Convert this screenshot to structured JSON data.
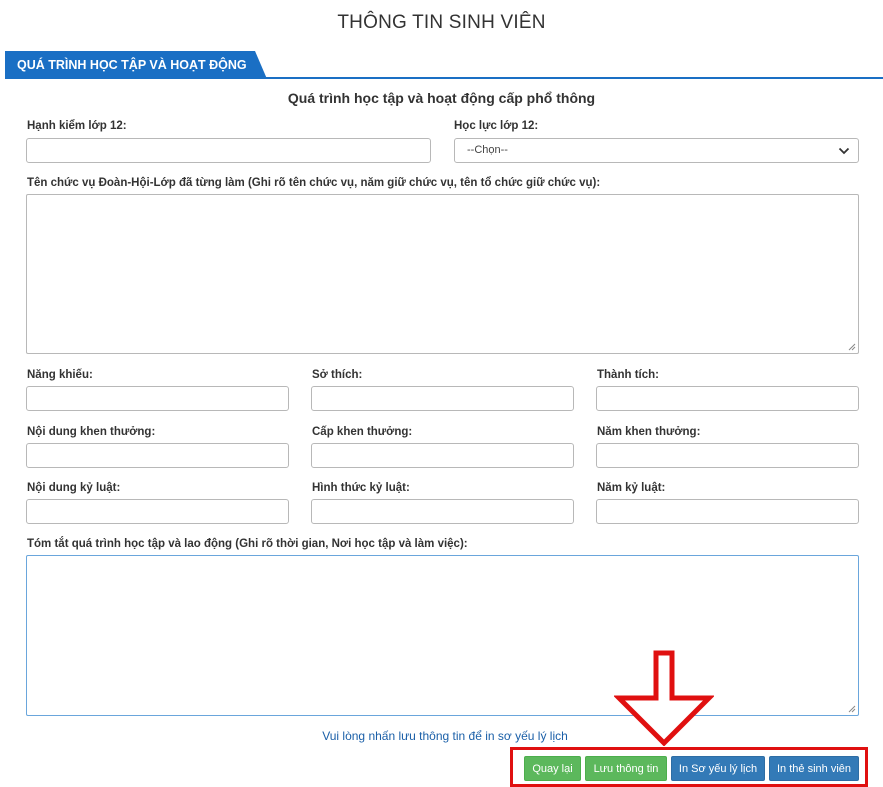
{
  "page": {
    "title": "THÔNG TIN SINH VIÊN"
  },
  "section": {
    "tab_label": "QUÁ TRÌNH HỌC TẬP VÀ HOẠT ĐỘNG",
    "subtitle": "Quá trình học tập và hoạt động cấp phổ thông"
  },
  "form": {
    "conduct_grade12_label": "Hạnh kiểm lớp 12:",
    "conduct_grade12_value": "",
    "academic_grade12_label": "Học lực lớp 12:",
    "academic_grade12_selected": "--Chọn--",
    "positions_label": "Tên chức vụ Đoàn-Hội-Lớp đã từng làm (Ghi rõ tên chức vụ, năm giữ chức vụ, tên tổ chức giữ chức vụ):",
    "positions_value": "",
    "talent_label": "Năng khiếu:",
    "hobby_label": "Sở thích:",
    "achievement_label": "Thành tích:",
    "reward_content_label": "Nội dung khen thưởng:",
    "reward_level_label": "Cấp khen thưởng:",
    "reward_year_label": "Năm khen thưởng:",
    "discipline_content_label": "Nội dung kỷ luật:",
    "discipline_form_label": "Hình thức kỷ luật:",
    "discipline_year_label": "Năm kỷ luật:",
    "summary_label": "Tóm tắt quá trình học tập và lao động (Ghi rõ thời gian, Nơi học tập và làm việc):",
    "summary_value": ""
  },
  "hint": "Vui lòng nhấn lưu thông tin để in sơ yếu lý lịch",
  "buttons": {
    "back": "Quay lại",
    "save": "Lưu thông tin",
    "print_cv": "In Sơ yếu lý lịch",
    "print_card": "In thẻ sinh viên"
  },
  "colors": {
    "primary_blue": "#1a6fc4",
    "button_green": "#5cb85c",
    "button_blue": "#337ab7",
    "highlight_red": "#e01010",
    "hint_link": "#1a5fa8"
  },
  "icons": {
    "select_caret": "chevron-down-icon",
    "annotation": "red-down-arrow"
  }
}
